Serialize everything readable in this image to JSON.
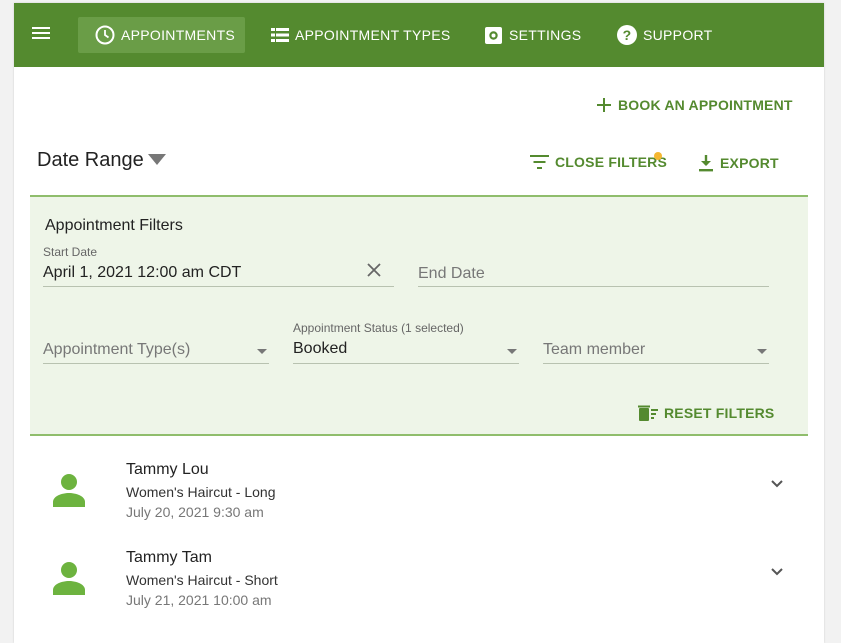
{
  "nav": {
    "items": [
      {
        "label": "Appointments",
        "icon": "clock-icon",
        "active": true
      },
      {
        "label": "Appointment Types",
        "icon": "list-icon",
        "active": false
      },
      {
        "label": "Settings",
        "icon": "gear-icon",
        "active": false
      },
      {
        "label": "Support",
        "icon": "help-icon",
        "active": false
      }
    ]
  },
  "toolbar": {
    "book_label": "Book an appointment",
    "date_range_label": "Date Range",
    "close_filters_label": "Close filters",
    "export_label": "Export"
  },
  "filters": {
    "title": "Appointment Filters",
    "start_date": {
      "label": "Start Date",
      "value": "April 1, 2021 12:00 am CDT"
    },
    "end_date": {
      "placeholder": "End Date"
    },
    "appointment_types": {
      "placeholder": "Appointment Type(s)"
    },
    "appointment_status": {
      "label": "Appointment Status (1 selected)",
      "value": "Booked"
    },
    "team_member": {
      "placeholder": "Team member"
    },
    "reset_label": "Reset filters"
  },
  "appointments": [
    {
      "name": "Tammy Lou",
      "type": "Women's Haircut - Long",
      "time": "July 20, 2021 9:30 am"
    },
    {
      "name": "Tammy Tam",
      "type": "Women's Haircut - Short",
      "time": "July 21, 2021 10:00 am"
    }
  ],
  "colors": {
    "primary": "#548a2f",
    "nav_active": "#6a9d47",
    "filter_bg": "#eef5e8",
    "avatar": "#6db33f",
    "badge_dot": "#f5b731"
  }
}
